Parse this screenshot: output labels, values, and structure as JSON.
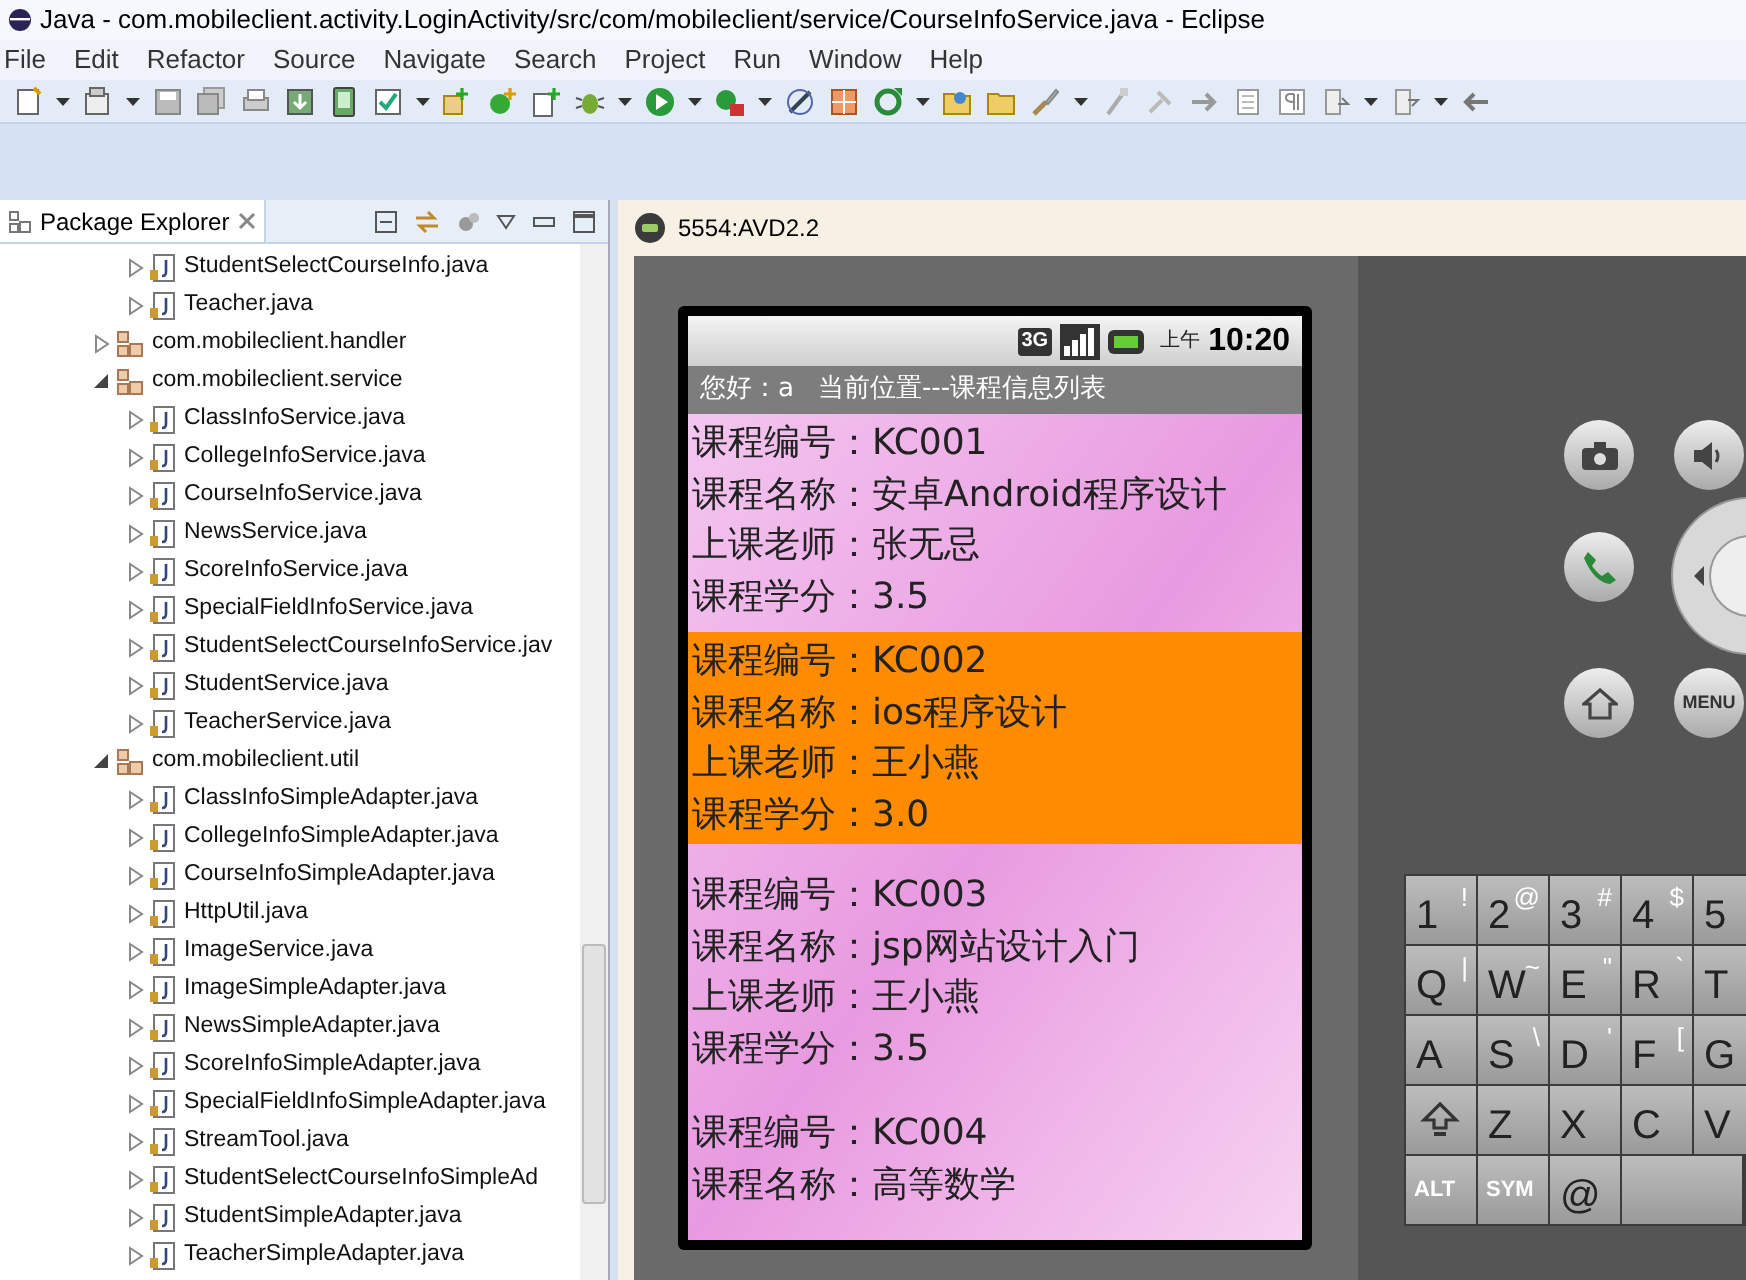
{
  "window": {
    "title": "Java - com.mobileclient.activity.LoginActivity/src/com/mobileclient/service/CourseInfoService.java - Eclipse"
  },
  "menu": [
    "File",
    "Edit",
    "Refactor",
    "Source",
    "Navigate",
    "Search",
    "Project",
    "Run",
    "Window",
    "Help"
  ],
  "package_explorer": {
    "title": "Package Explorer",
    "leading_files": [
      "StudentSelectCourseInfo.java",
      "Teacher.java"
    ],
    "packages": [
      {
        "label": "com.mobileclient.handler",
        "expanded": false
      },
      {
        "label": "com.mobileclient.service",
        "expanded": true,
        "children": [
          "ClassInfoService.java",
          "CollegeInfoService.java",
          "CourseInfoService.java",
          "NewsService.java",
          "ScoreInfoService.java",
          "SpecialFieldInfoService.java",
          "StudentSelectCourseInfoService.jav",
          "StudentService.java",
          "TeacherService.java"
        ]
      },
      {
        "label": "com.mobileclient.util",
        "expanded": true,
        "children": [
          "ClassInfoSimpleAdapter.java",
          "CollegeInfoSimpleAdapter.java",
          "CourseInfoSimpleAdapter.java",
          "HttpUtil.java",
          "ImageService.java",
          "ImageSimpleAdapter.java",
          "NewsSimpleAdapter.java",
          "ScoreInfoSimpleAdapter.java",
          "SpecialFieldInfoSimpleAdapter.java",
          "StreamTool.java",
          "StudentSelectCourseInfoSimpleAd",
          "StudentSimpleAdapter.java",
          "TeacherSimpleAdapter.java"
        ]
      }
    ]
  },
  "emulator": {
    "title": "5554:AVD2.2",
    "status_bar": {
      "network": "3G",
      "period": "上午",
      "time": "10:20"
    },
    "title_bar": {
      "greeting": "您好：a",
      "location": "当前位置---课程信息列表"
    },
    "courses": [
      {
        "selected": false,
        "lines": [
          "课程编号：KC001",
          "课程名称：安卓Android程序设计",
          "上课老师：张无忌",
          "课程学分：3.5"
        ]
      },
      {
        "selected": true,
        "lines": [
          "课程编号：KC002",
          "课程名称：ios程序设计",
          "上课老师：王小燕",
          "课程学分：3.0"
        ]
      },
      {
        "selected": false,
        "lines": [
          "课程编号：KC003",
          "课程名称：jsp网站设计入门",
          "上课老师：王小燕",
          "课程学分：3.5"
        ]
      },
      {
        "selected": false,
        "lines": [
          "课程编号：KC004",
          "课程名称：高等数学"
        ]
      }
    ],
    "menu_button": "MENU",
    "keyboard": [
      [
        {
          "kind": "char",
          "main": "1",
          "alt": "!"
        },
        {
          "kind": "char",
          "main": "2",
          "alt": "@"
        },
        {
          "kind": "char",
          "main": "3",
          "alt": "#"
        },
        {
          "kind": "char",
          "main": "4",
          "alt": "$"
        },
        {
          "kind": "char",
          "main": "5"
        }
      ],
      [
        {
          "kind": "char",
          "main": "Q",
          "alt": "|"
        },
        {
          "kind": "char",
          "main": "W",
          "alt": "~"
        },
        {
          "kind": "char",
          "main": "E",
          "alt": "\""
        },
        {
          "kind": "char",
          "main": "R",
          "alt": "`"
        },
        {
          "kind": "char",
          "main": "T"
        }
      ],
      [
        {
          "kind": "char",
          "main": "A"
        },
        {
          "kind": "char",
          "main": "S",
          "alt": "\\"
        },
        {
          "kind": "char",
          "main": "D",
          "alt": "'"
        },
        {
          "kind": "char",
          "main": "F",
          "alt": "["
        },
        {
          "kind": "char",
          "main": "G"
        }
      ],
      [
        {
          "kind": "shift"
        },
        {
          "kind": "char",
          "main": "Z"
        },
        {
          "kind": "char",
          "main": "X"
        },
        {
          "kind": "char",
          "main": "C"
        },
        {
          "kind": "char",
          "main": "V"
        }
      ],
      [
        {
          "kind": "label",
          "main": "ALT"
        },
        {
          "kind": "label",
          "main": "SYM"
        },
        {
          "kind": "char",
          "main": "@"
        },
        {
          "kind": "space"
        }
      ]
    ]
  }
}
